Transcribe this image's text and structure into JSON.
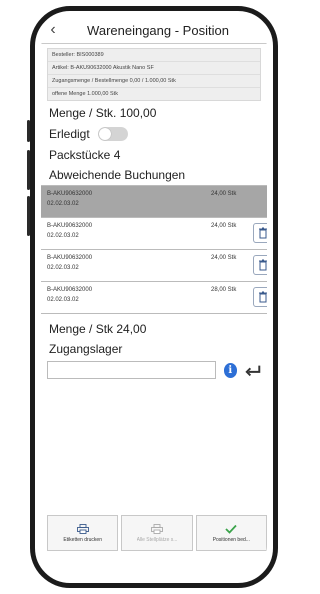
{
  "header": {
    "title": "Wareneingang - Position",
    "back_icon": "chevron-left-icon"
  },
  "info": {
    "bestellnr": "Besteller: BIS000389",
    "artikel": "Artikel: B-AKU90632000 Akustik Nano SF",
    "zugang": "Zugangsmenge / Bestellmenge 0,00 / 1.000,00 Stk",
    "offen": "offene Menge 1.000,00 Stk"
  },
  "menge": "Menge / Stk. 100,00",
  "erledigt": {
    "label": "Erledigt",
    "state": "off"
  },
  "packstuecke": "Packstücke 4",
  "abweichende": "Abweichende Buchungen",
  "rows": [
    {
      "article": "B-AKU90632000",
      "date": "02.02.03.02",
      "qty": "24,00 Stk",
      "selected": true
    },
    {
      "article": "B-AKU90632000",
      "date": "02.02.03.02",
      "qty": "24,00 Stk",
      "selected": false
    },
    {
      "article": "B-AKU90632000",
      "date": "02.02.03.02",
      "qty": "24,00 Stk",
      "selected": false
    },
    {
      "article": "B-AKU90632000",
      "date": "02.02.03.02",
      "qty": "28,00 Stk",
      "selected": false
    }
  ],
  "menge2": "Menge / Stk 24,00",
  "zugangslager": {
    "label": "Zugangslager",
    "value": "",
    "placeholder": ""
  },
  "footer": {
    "print": "Etiketten drucken",
    "all": "Alle Stellplätze s...",
    "confirm": "Positionen bed..."
  },
  "colors": {
    "accent": "#2d6fd6",
    "selected_row": "#a6a6a6",
    "confirm_check": "#3aa34a"
  }
}
